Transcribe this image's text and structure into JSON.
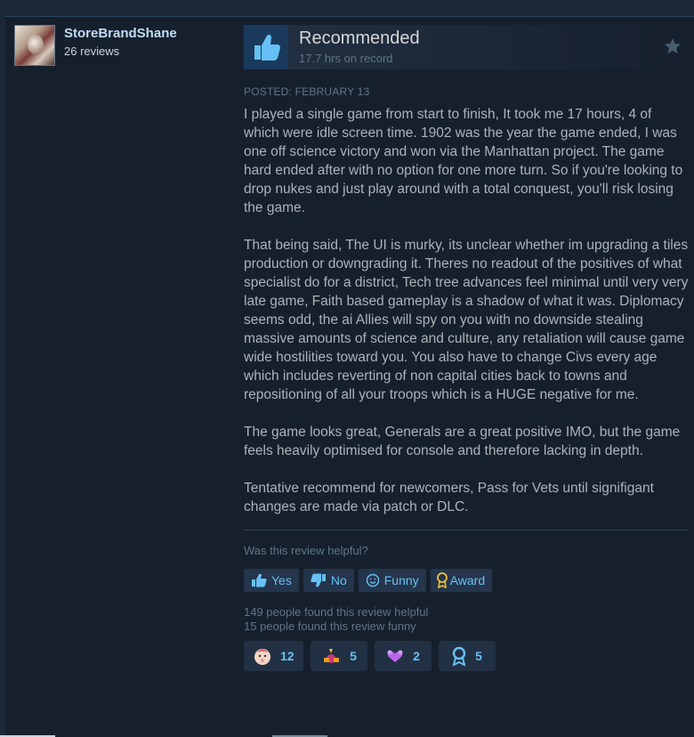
{
  "author": {
    "name": "StoreBrandShane",
    "reviews": "26 reviews"
  },
  "vote": {
    "title": "Recommended",
    "hours": "17.7 hrs on record"
  },
  "posted": "POSTED: FEBRUARY 13",
  "body": [
    "I played a single game from start to finish, It took me 17 hours, 4 of which were idle screen time. 1902 was the year the game ended, I was one off science victory and won via the Manhattan project. The game hard ended after with no option for one more turn. So if you're looking to drop nukes and just play around with a total conquest, you'll risk losing the game.",
    "That being said, The UI is murky, its unclear whether im upgrading a tiles production or downgrading it. Theres no readout of the positives of what specialist do for a district, Tech tree advances feel minimal until very very late game, Faith based gameplay is a shadow of what it was. Diplomacy seems odd, the ai Allies will spy on you with no downside stealing massive amounts of science and culture, any retaliation will cause game wide hostilities toward you. You also have to change Civs every age which includes reverting of non capital cities back to towns and repositioning of all your troops which is a HUGE negative for me.",
    "The game looks great, Generals are a great positive IMO, but the game feels heavily optimised for console and therefore lacking in depth.",
    "Tentative recommend for newcomers, Pass for Vets until signifigant changes are made via patch or DLC."
  ],
  "helpful_question": "Was this review helpful?",
  "buttons": {
    "yes": "Yes",
    "no": "No",
    "funny": "Funny",
    "award": "Award"
  },
  "stats": {
    "helpful": "149 people found this review helpful",
    "funny": "15 people found this review funny"
  },
  "awards": [
    {
      "icon": "baby-face-award-icon",
      "count": "12"
    },
    {
      "icon": "party-award-icon",
      "count": "5"
    },
    {
      "icon": "heart-hands-award-icon",
      "count": "2"
    },
    {
      "icon": "medal-award-icon",
      "count": "5"
    }
  ],
  "colors": {
    "background": "#1b2838",
    "panel": "#16202d",
    "link": "#67c1f5",
    "author": "#c1dbf4"
  }
}
